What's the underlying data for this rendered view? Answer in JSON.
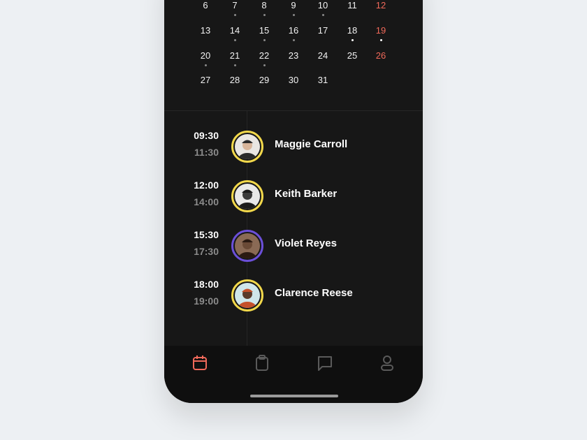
{
  "calendar": {
    "weeks": [
      [
        {
          "d": "6"
        },
        {
          "d": "7",
          "dot": "grey"
        },
        {
          "d": "8",
          "dot": "grey"
        },
        {
          "d": "9",
          "dot": "grey"
        },
        {
          "d": "10",
          "dot": "grey"
        },
        {
          "d": "11"
        },
        {
          "d": "12",
          "weekend": true
        }
      ],
      [
        {
          "d": "13"
        },
        {
          "d": "14",
          "dot": "grey"
        },
        {
          "d": "15",
          "dot": "grey"
        },
        {
          "d": "16",
          "dot": "grey"
        },
        {
          "d": "17"
        },
        {
          "d": "18",
          "dot": "white"
        },
        {
          "d": "19",
          "weekend": true,
          "dot": "white"
        }
      ],
      [
        {
          "d": "20",
          "dot": "grey"
        },
        {
          "d": "21",
          "dot": "grey"
        },
        {
          "d": "22",
          "dot": "grey"
        },
        {
          "d": "23"
        },
        {
          "d": "24"
        },
        {
          "d": "25"
        },
        {
          "d": "26",
          "weekend": true
        }
      ],
      [
        {
          "d": "27"
        },
        {
          "d": "28"
        },
        {
          "d": "29"
        },
        {
          "d": "30"
        },
        {
          "d": "31"
        }
      ]
    ]
  },
  "appointments": [
    {
      "start": "09:30",
      "end": "11:30",
      "name": "Maggie Carroll",
      "ring": "#f2d84b",
      "bg": "#e9e6e2",
      "skin": "#d8b59a",
      "hair": "#2a2a2a"
    },
    {
      "start": "12:00",
      "end": "14:00",
      "name": "Keith Barker",
      "ring": "#f2d84b",
      "bg": "#e8e8e8",
      "skin": "#3a3a3a",
      "hair": "#1a1a1a"
    },
    {
      "start": "15:30",
      "end": "17:30",
      "name": "Violet Reyes",
      "ring": "#6b4fd8",
      "bg": "#8a6a55",
      "skin": "#6a4a36",
      "hair": "#2a1a12"
    },
    {
      "start": "18:00",
      "end": "19:00",
      "name": "Clarence Reese",
      "ring": "#f2d84b",
      "bg": "#cfe6ea",
      "skin": "#5a3a2a",
      "hair": "#c4502a"
    }
  ],
  "tabs": [
    {
      "icon": "calendar-icon",
      "active": true
    },
    {
      "icon": "clipboard-icon"
    },
    {
      "icon": "chat-icon"
    },
    {
      "icon": "user-icon"
    }
  ],
  "colors": {
    "accent": "#f0695a",
    "inactive": "#5a5a5a"
  }
}
